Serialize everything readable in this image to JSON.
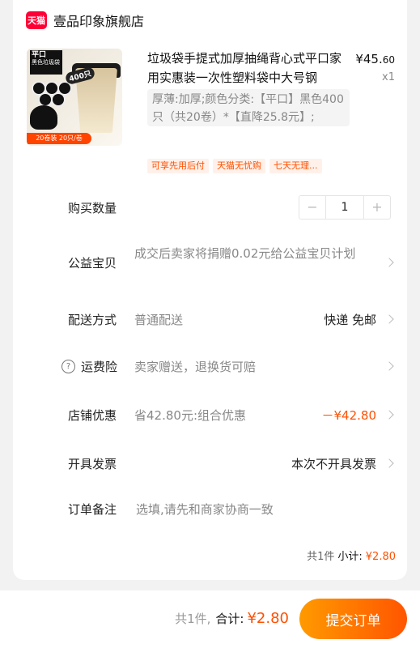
{
  "store": {
    "badge": "天猫",
    "name": "壹品印象旗舰店"
  },
  "product": {
    "thumb_tag_big": "平口",
    "thumb_tag_small": "黑色垃圾袋",
    "thumb_qty": "400只",
    "thumb_strip": "20卷装 20只/卷",
    "title": "垃圾袋手提式加厚抽绳背心式平口家用实惠装一次性塑料袋中大号钢",
    "price_major": "¥45.",
    "price_minor": "60",
    "count": "x1",
    "sku": "厚薄:加厚;颜色分类:【平口】黑色400只（共20卷）*【直降25.8元】;",
    "tags": [
      "可享先用后付",
      "天猫无忧购",
      "七天无理..."
    ]
  },
  "quantity": {
    "label": "购买数量",
    "minus": "−",
    "value": "1",
    "plus": "+"
  },
  "welfare": {
    "label": "公益宝贝",
    "text": "成交后卖家将捐赠0.02元给公益宝贝计划"
  },
  "delivery": {
    "label": "配送方式",
    "value": "普通配送",
    "right": "快递 免邮"
  },
  "shipping_insurance": {
    "label": "运费险",
    "value": "卖家赠送，退换货可赔"
  },
  "store_discount": {
    "label": "店铺优惠",
    "value": "省42.80元:组合优惠",
    "amount": "－¥42.80"
  },
  "invoice": {
    "label": "开具发票",
    "right": "本次不开具发票"
  },
  "remark": {
    "label": "订单备注",
    "placeholder": "选填,请先和商家协商一致"
  },
  "subtotal": {
    "count": "共1件",
    "label": "小计:",
    "amount": "¥2.80"
  },
  "footer": {
    "count": "共1件,",
    "label": "合计:",
    "amount": "¥2.80",
    "submit": "提交订单"
  }
}
